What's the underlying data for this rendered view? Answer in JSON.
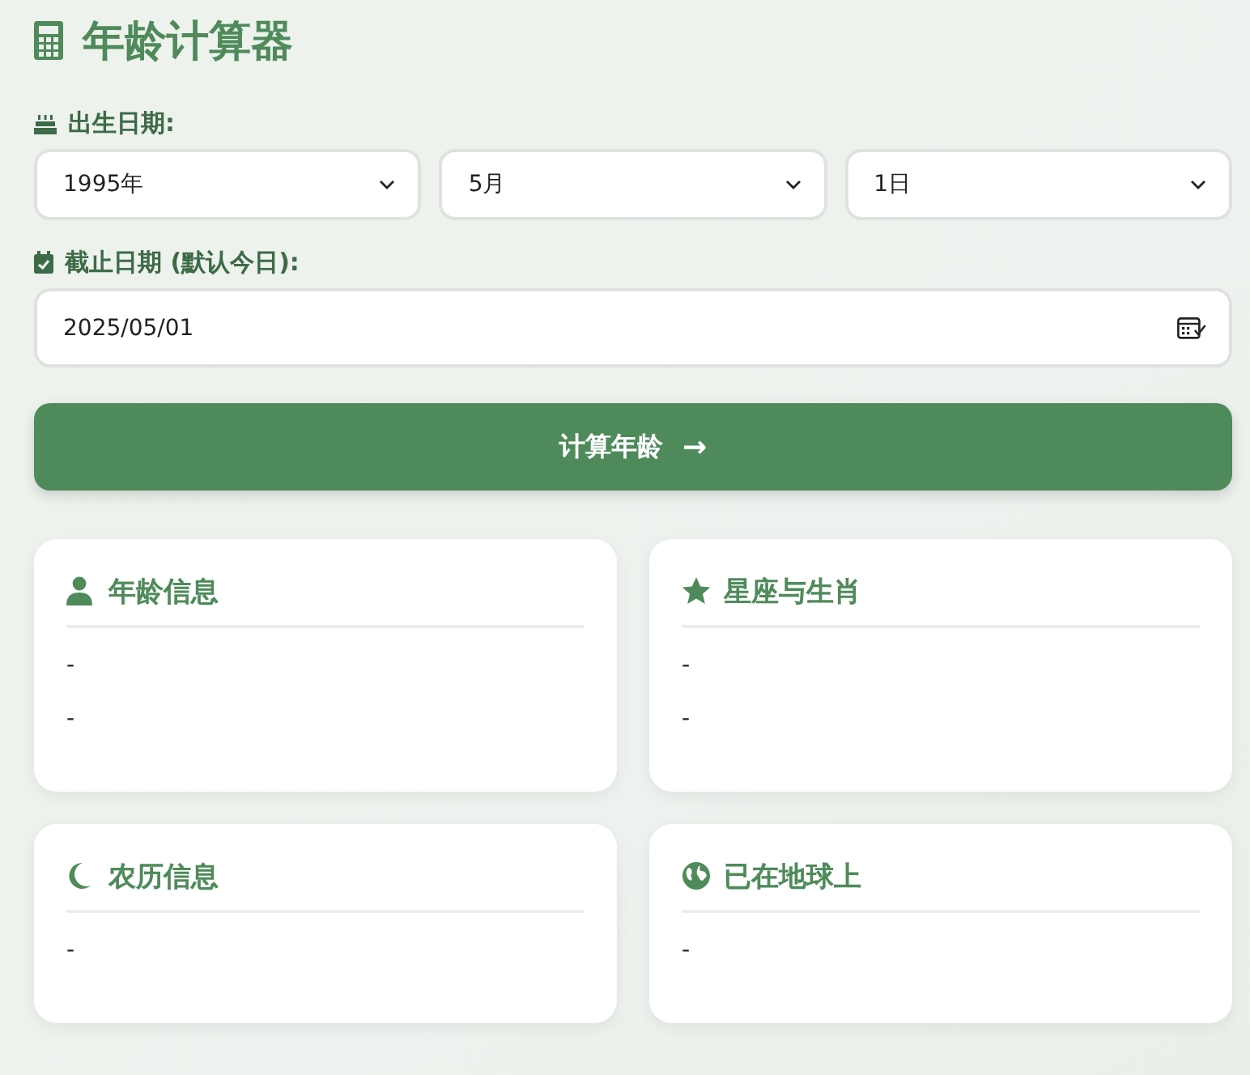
{
  "title": "年龄计算器",
  "birth": {
    "label": "出生日期:",
    "selects": [
      {
        "value": "1995年"
      },
      {
        "value": "5月"
      },
      {
        "value": "1日"
      }
    ]
  },
  "end": {
    "label": "截止日期 (默认今日):",
    "value": "2025/05/01"
  },
  "button": {
    "label": "计算年龄",
    "arrow": "→"
  },
  "cards": [
    {
      "kind": "person",
      "title": "年龄信息",
      "lines": [
        "-",
        "-"
      ]
    },
    {
      "kind": "star",
      "title": "星座与生肖",
      "lines": [
        "-",
        "-"
      ]
    },
    {
      "kind": "moon",
      "title": "农历信息",
      "lines": [
        "-"
      ]
    },
    {
      "kind": "globe",
      "title": "已在地球上",
      "lines": [
        "-"
      ]
    }
  ]
}
